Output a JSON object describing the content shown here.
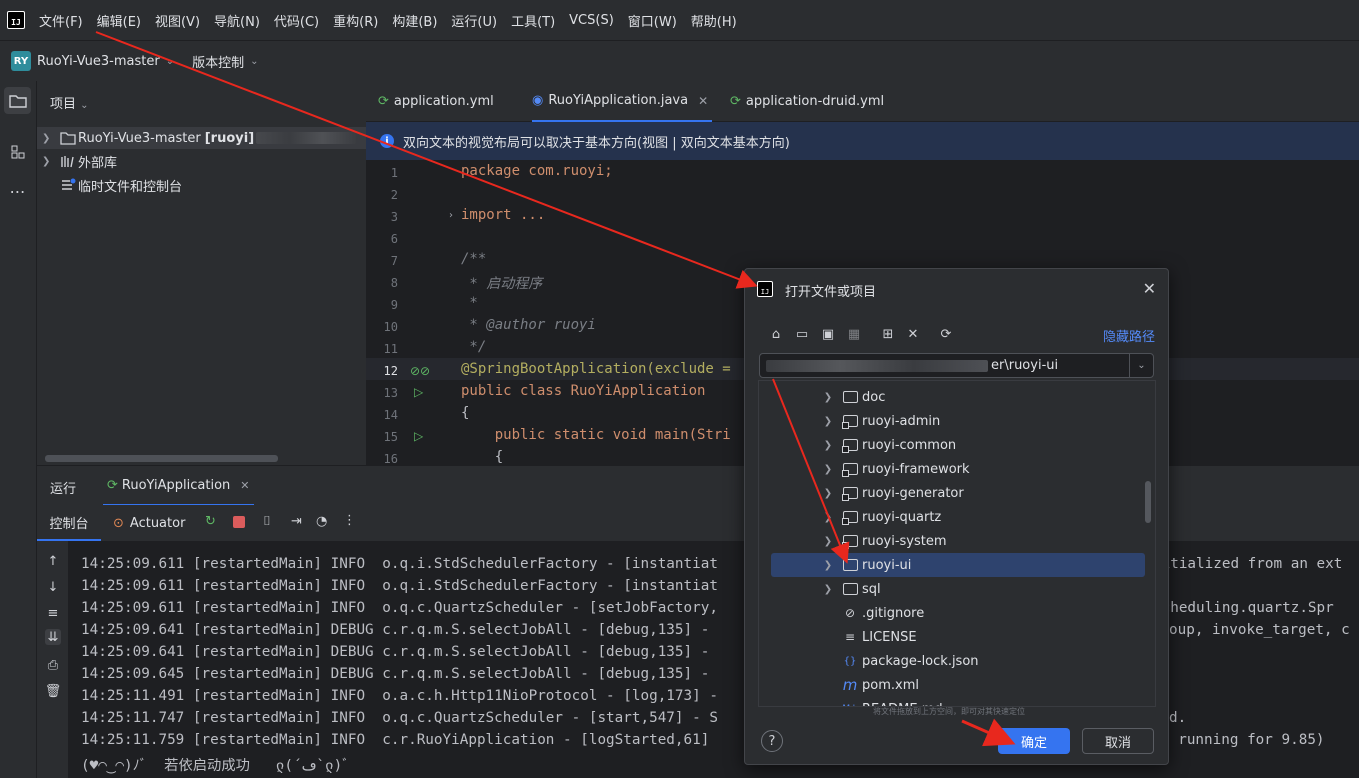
{
  "menu": [
    "文件(F)",
    "编辑(E)",
    "视图(V)",
    "导航(N)",
    "代码(C)",
    "重构(R)",
    "构建(B)",
    "运行(U)",
    "工具(T)",
    "VCS(S)",
    "窗口(W)",
    "帮助(H)"
  ],
  "toolbar": {
    "project_badge": "RY",
    "project_name": "RuoYi-Vue3-master",
    "vcs": "版本控制"
  },
  "project_panel": {
    "header": "项目",
    "items": [
      {
        "label": "RuoYi-Vue3-master",
        "bold_suffix": "[ruoyi]"
      },
      {
        "label": "外部库"
      },
      {
        "label": "临时文件和控制台"
      }
    ]
  },
  "editor_tabs": [
    "application.yml",
    "RuoYiApplication.java",
    "application-druid.yml"
  ],
  "banner": {
    "icon": "info-icon",
    "text": "双向文本的视觉布局可以取决于基本方向(视图 | 双向文本基本方向)"
  },
  "code_lines": [
    {
      "n": "1",
      "text": "package com.ruoyi;"
    },
    {
      "n": "2",
      "text": ""
    },
    {
      "n": "3",
      "text": "import ..."
    },
    {
      "n": "6",
      "text": ""
    },
    {
      "n": "7",
      "text": "/**"
    },
    {
      "n": "8",
      "text": " * 启动程序"
    },
    {
      "n": "9",
      "text": " *"
    },
    {
      "n": "10",
      "text": " * @author ruoyi"
    },
    {
      "n": "11",
      "text": " */"
    },
    {
      "n": "12",
      "text": "@SpringBootApplication(exclude = "
    },
    {
      "n": "13",
      "text": "public class RuoYiApplication"
    },
    {
      "n": "14",
      "text": "{"
    },
    {
      "n": "15",
      "text": "    public static void main(Stri"
    },
    {
      "n": "16",
      "text": "    {"
    }
  ],
  "run_panel": {
    "title": "运行",
    "tab": "RuoYiApplication",
    "console_tab": "控制台",
    "actuator_tab": "Actuator"
  },
  "console_lines": [
    {
      "left": "14:25:09.611 [restartedMain] INFO  o.q.i.StdSchedulerFactory - [instantiat",
      "right": "nitialized from an ext"
    },
    {
      "left": "14:25:09.611 [restartedMain] INFO  o.q.i.StdSchedulerFactory - [instantiat",
      "right": ""
    },
    {
      "left": "14:25:09.611 [restartedMain] INFO  o.q.c.QuartzScheduler - [setJobFactory,",
      "right": "scheduling.quartz.Spr"
    },
    {
      "left": "14:25:09.641 [restartedMain] DEBUG c.r.q.m.S.selectJobAll - [debug,135] -",
      "right": "oup, invoke_target, c"
    },
    {
      "left": "14:25:09.641 [restartedMain] DEBUG c.r.q.m.S.selectJobAll - [debug,135] -",
      "right": ""
    },
    {
      "left": "14:25:09.645 [restartedMain] DEBUG c.r.q.m.S.selectJobAll - [debug,135] -",
      "right": ""
    },
    {
      "left": "14:25:11.491 [restartedMain] INFO  o.a.c.h.Http11NioProtocol - [log,173] -",
      "right": ""
    },
    {
      "left": "14:25:11.747 [restartedMain] INFO  o.q.c.QuartzScheduler - [start,547] - S",
      "right": "d."
    },
    {
      "left": "14:25:11.759 [restartedMain] INFO  c.r.RuoYiApplication - [logStarted,61]",
      "right": "M running for 9.85)"
    },
    {
      "left": "(♥◠‿◠)ﾉﾞ  若依启动成功   ლ(´ڡ`ლ)ﾞ",
      "right": ""
    }
  ],
  "dialog": {
    "title": "打开文件或项目",
    "hide_path": "隐藏路径",
    "path_suffix": "er\\ruoyi-ui",
    "files": [
      {
        "name": "doc",
        "type": "folder",
        "expandable": true,
        "selected": false
      },
      {
        "name": "ruoyi-admin",
        "type": "module-folder",
        "expandable": true,
        "selected": false
      },
      {
        "name": "ruoyi-common",
        "type": "module-folder",
        "expandable": true,
        "selected": false
      },
      {
        "name": "ruoyi-framework",
        "type": "module-folder",
        "expandable": true,
        "selected": false
      },
      {
        "name": "ruoyi-generator",
        "type": "module-folder",
        "expandable": true,
        "selected": false
      },
      {
        "name": "ruoyi-quartz",
        "type": "module-folder",
        "expandable": true,
        "selected": false
      },
      {
        "name": "ruoyi-system",
        "type": "module-folder",
        "expandable": true,
        "selected": false
      },
      {
        "name": "ruoyi-ui",
        "type": "folder",
        "expandable": true,
        "selected": true
      },
      {
        "name": "sql",
        "type": "folder",
        "expandable": true,
        "selected": false
      },
      {
        "name": ".gitignore",
        "type": "gitignore",
        "expandable": false,
        "selected": false
      },
      {
        "name": "LICENSE",
        "type": "text",
        "expandable": false,
        "selected": false
      },
      {
        "name": "package-lock.json",
        "type": "json",
        "expandable": false,
        "selected": false
      },
      {
        "name": "pom.xml",
        "type": "maven",
        "expandable": false,
        "selected": false
      },
      {
        "name": "README.md",
        "type": "markdown",
        "expandable": false,
        "selected": false
      }
    ],
    "hint": "将文件拖放到上方空间，即可对其快速定位",
    "ok": "确定",
    "cancel": "取消"
  },
  "colors": {
    "accent": "#3574f0",
    "annotation_arrow": "#e8281e"
  }
}
